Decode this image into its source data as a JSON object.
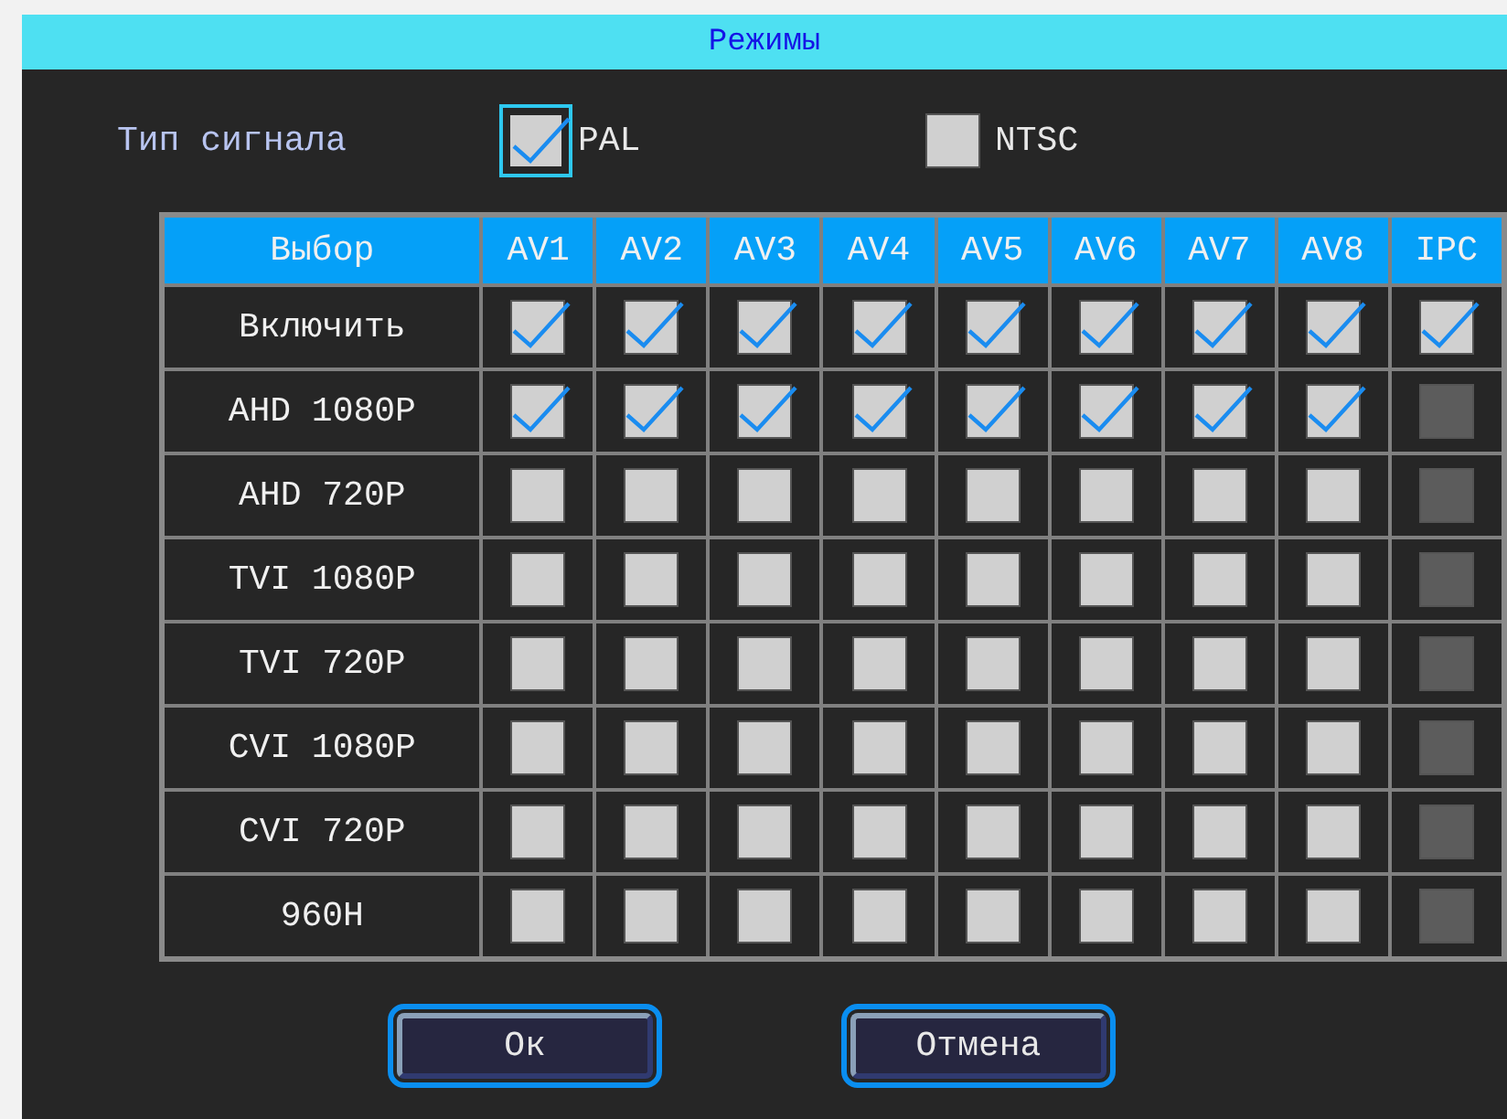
{
  "window": {
    "title": "Режимы"
  },
  "signal": {
    "label": "Тип сигнала",
    "options": [
      {
        "label": "PAL",
        "checked": true,
        "focused": true
      },
      {
        "label": "NTSC",
        "checked": false,
        "focused": false
      }
    ]
  },
  "table": {
    "columns": [
      "Выбор",
      "AV1",
      "AV2",
      "AV3",
      "AV4",
      "AV5",
      "AV6",
      "AV7",
      "AV8",
      "IPC"
    ],
    "rows": [
      {
        "label": "Включить",
        "cells": [
          {
            "checked": true,
            "disabled": false
          },
          {
            "checked": true,
            "disabled": false
          },
          {
            "checked": true,
            "disabled": false
          },
          {
            "checked": true,
            "disabled": false
          },
          {
            "checked": true,
            "disabled": false
          },
          {
            "checked": true,
            "disabled": false
          },
          {
            "checked": true,
            "disabled": false
          },
          {
            "checked": true,
            "disabled": false
          },
          {
            "checked": true,
            "disabled": false
          }
        ]
      },
      {
        "label": "AHD 1080P",
        "cells": [
          {
            "checked": true,
            "disabled": false
          },
          {
            "checked": true,
            "disabled": false
          },
          {
            "checked": true,
            "disabled": false
          },
          {
            "checked": true,
            "disabled": false
          },
          {
            "checked": true,
            "disabled": false
          },
          {
            "checked": true,
            "disabled": false
          },
          {
            "checked": true,
            "disabled": false
          },
          {
            "checked": true,
            "disabled": false
          },
          {
            "checked": false,
            "disabled": true
          }
        ]
      },
      {
        "label": "AHD 720P",
        "cells": [
          {
            "checked": false,
            "disabled": false
          },
          {
            "checked": false,
            "disabled": false
          },
          {
            "checked": false,
            "disabled": false
          },
          {
            "checked": false,
            "disabled": false
          },
          {
            "checked": false,
            "disabled": false
          },
          {
            "checked": false,
            "disabled": false
          },
          {
            "checked": false,
            "disabled": false
          },
          {
            "checked": false,
            "disabled": false
          },
          {
            "checked": false,
            "disabled": true
          }
        ]
      },
      {
        "label": "TVI 1080P",
        "cells": [
          {
            "checked": false,
            "disabled": false
          },
          {
            "checked": false,
            "disabled": false
          },
          {
            "checked": false,
            "disabled": false
          },
          {
            "checked": false,
            "disabled": false
          },
          {
            "checked": false,
            "disabled": false
          },
          {
            "checked": false,
            "disabled": false
          },
          {
            "checked": false,
            "disabled": false
          },
          {
            "checked": false,
            "disabled": false
          },
          {
            "checked": false,
            "disabled": true
          }
        ]
      },
      {
        "label": "TVI 720P",
        "cells": [
          {
            "checked": false,
            "disabled": false
          },
          {
            "checked": false,
            "disabled": false
          },
          {
            "checked": false,
            "disabled": false
          },
          {
            "checked": false,
            "disabled": false
          },
          {
            "checked": false,
            "disabled": false
          },
          {
            "checked": false,
            "disabled": false
          },
          {
            "checked": false,
            "disabled": false
          },
          {
            "checked": false,
            "disabled": false
          },
          {
            "checked": false,
            "disabled": true
          }
        ]
      },
      {
        "label": "CVI 1080P",
        "cells": [
          {
            "checked": false,
            "disabled": false
          },
          {
            "checked": false,
            "disabled": false
          },
          {
            "checked": false,
            "disabled": false
          },
          {
            "checked": false,
            "disabled": false
          },
          {
            "checked": false,
            "disabled": false
          },
          {
            "checked": false,
            "disabled": false
          },
          {
            "checked": false,
            "disabled": false
          },
          {
            "checked": false,
            "disabled": false
          },
          {
            "checked": false,
            "disabled": true
          }
        ]
      },
      {
        "label": "CVI 720P",
        "cells": [
          {
            "checked": false,
            "disabled": false
          },
          {
            "checked": false,
            "disabled": false
          },
          {
            "checked": false,
            "disabled": false
          },
          {
            "checked": false,
            "disabled": false
          },
          {
            "checked": false,
            "disabled": false
          },
          {
            "checked": false,
            "disabled": false
          },
          {
            "checked": false,
            "disabled": false
          },
          {
            "checked": false,
            "disabled": false
          },
          {
            "checked": false,
            "disabled": true
          }
        ]
      },
      {
        "label": "960H",
        "cells": [
          {
            "checked": false,
            "disabled": false
          },
          {
            "checked": false,
            "disabled": false
          },
          {
            "checked": false,
            "disabled": false
          },
          {
            "checked": false,
            "disabled": false
          },
          {
            "checked": false,
            "disabled": false
          },
          {
            "checked": false,
            "disabled": false
          },
          {
            "checked": false,
            "disabled": false
          },
          {
            "checked": false,
            "disabled": false
          },
          {
            "checked": false,
            "disabled": true
          }
        ]
      }
    ]
  },
  "buttons": [
    {
      "label": "Ок",
      "focused": true
    },
    {
      "label": "Отмена",
      "focused": true
    }
  ]
}
